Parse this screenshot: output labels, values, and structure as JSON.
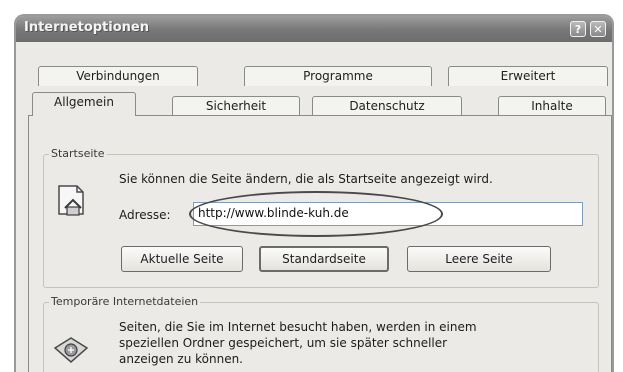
{
  "window": {
    "title": "Internetoptionen",
    "help_glyph": "?",
    "close_glyph": "✕"
  },
  "tabs_back": [
    {
      "label": "Verbindungen"
    },
    {
      "label": "Programme"
    },
    {
      "label": "Erweitert"
    }
  ],
  "tabs_front": [
    {
      "label": "Allgemein",
      "active": true
    },
    {
      "label": "Sicherheit"
    },
    {
      "label": "Datenschutz"
    },
    {
      "label": "Inhalte"
    }
  ],
  "startseite": {
    "legend": "Startseite",
    "description": "Sie können die Seite ändern, die als Startseite angezeigt wird.",
    "address_label": "Adresse:",
    "address_value": "http://www.blinde-kuh.de",
    "buttons": {
      "current": "Aktuelle Seite",
      "default": "Standardseite",
      "blank": "Leere Seite"
    }
  },
  "temp_files": {
    "legend": "Temporäre Internetdateien",
    "line1": "Seiten, die Sie im Internet besucht haben, werden in einem",
    "line2": "speziellen Ordner gespeichert, um sie später schneller",
    "line3": "anzeigen zu können."
  },
  "colors": {
    "titlebar": "#777777",
    "dialog": "#ebeae6",
    "field_border": "#7f9db9"
  },
  "icons": {
    "home": "home-page-icon",
    "temp": "temp-files-icon"
  }
}
